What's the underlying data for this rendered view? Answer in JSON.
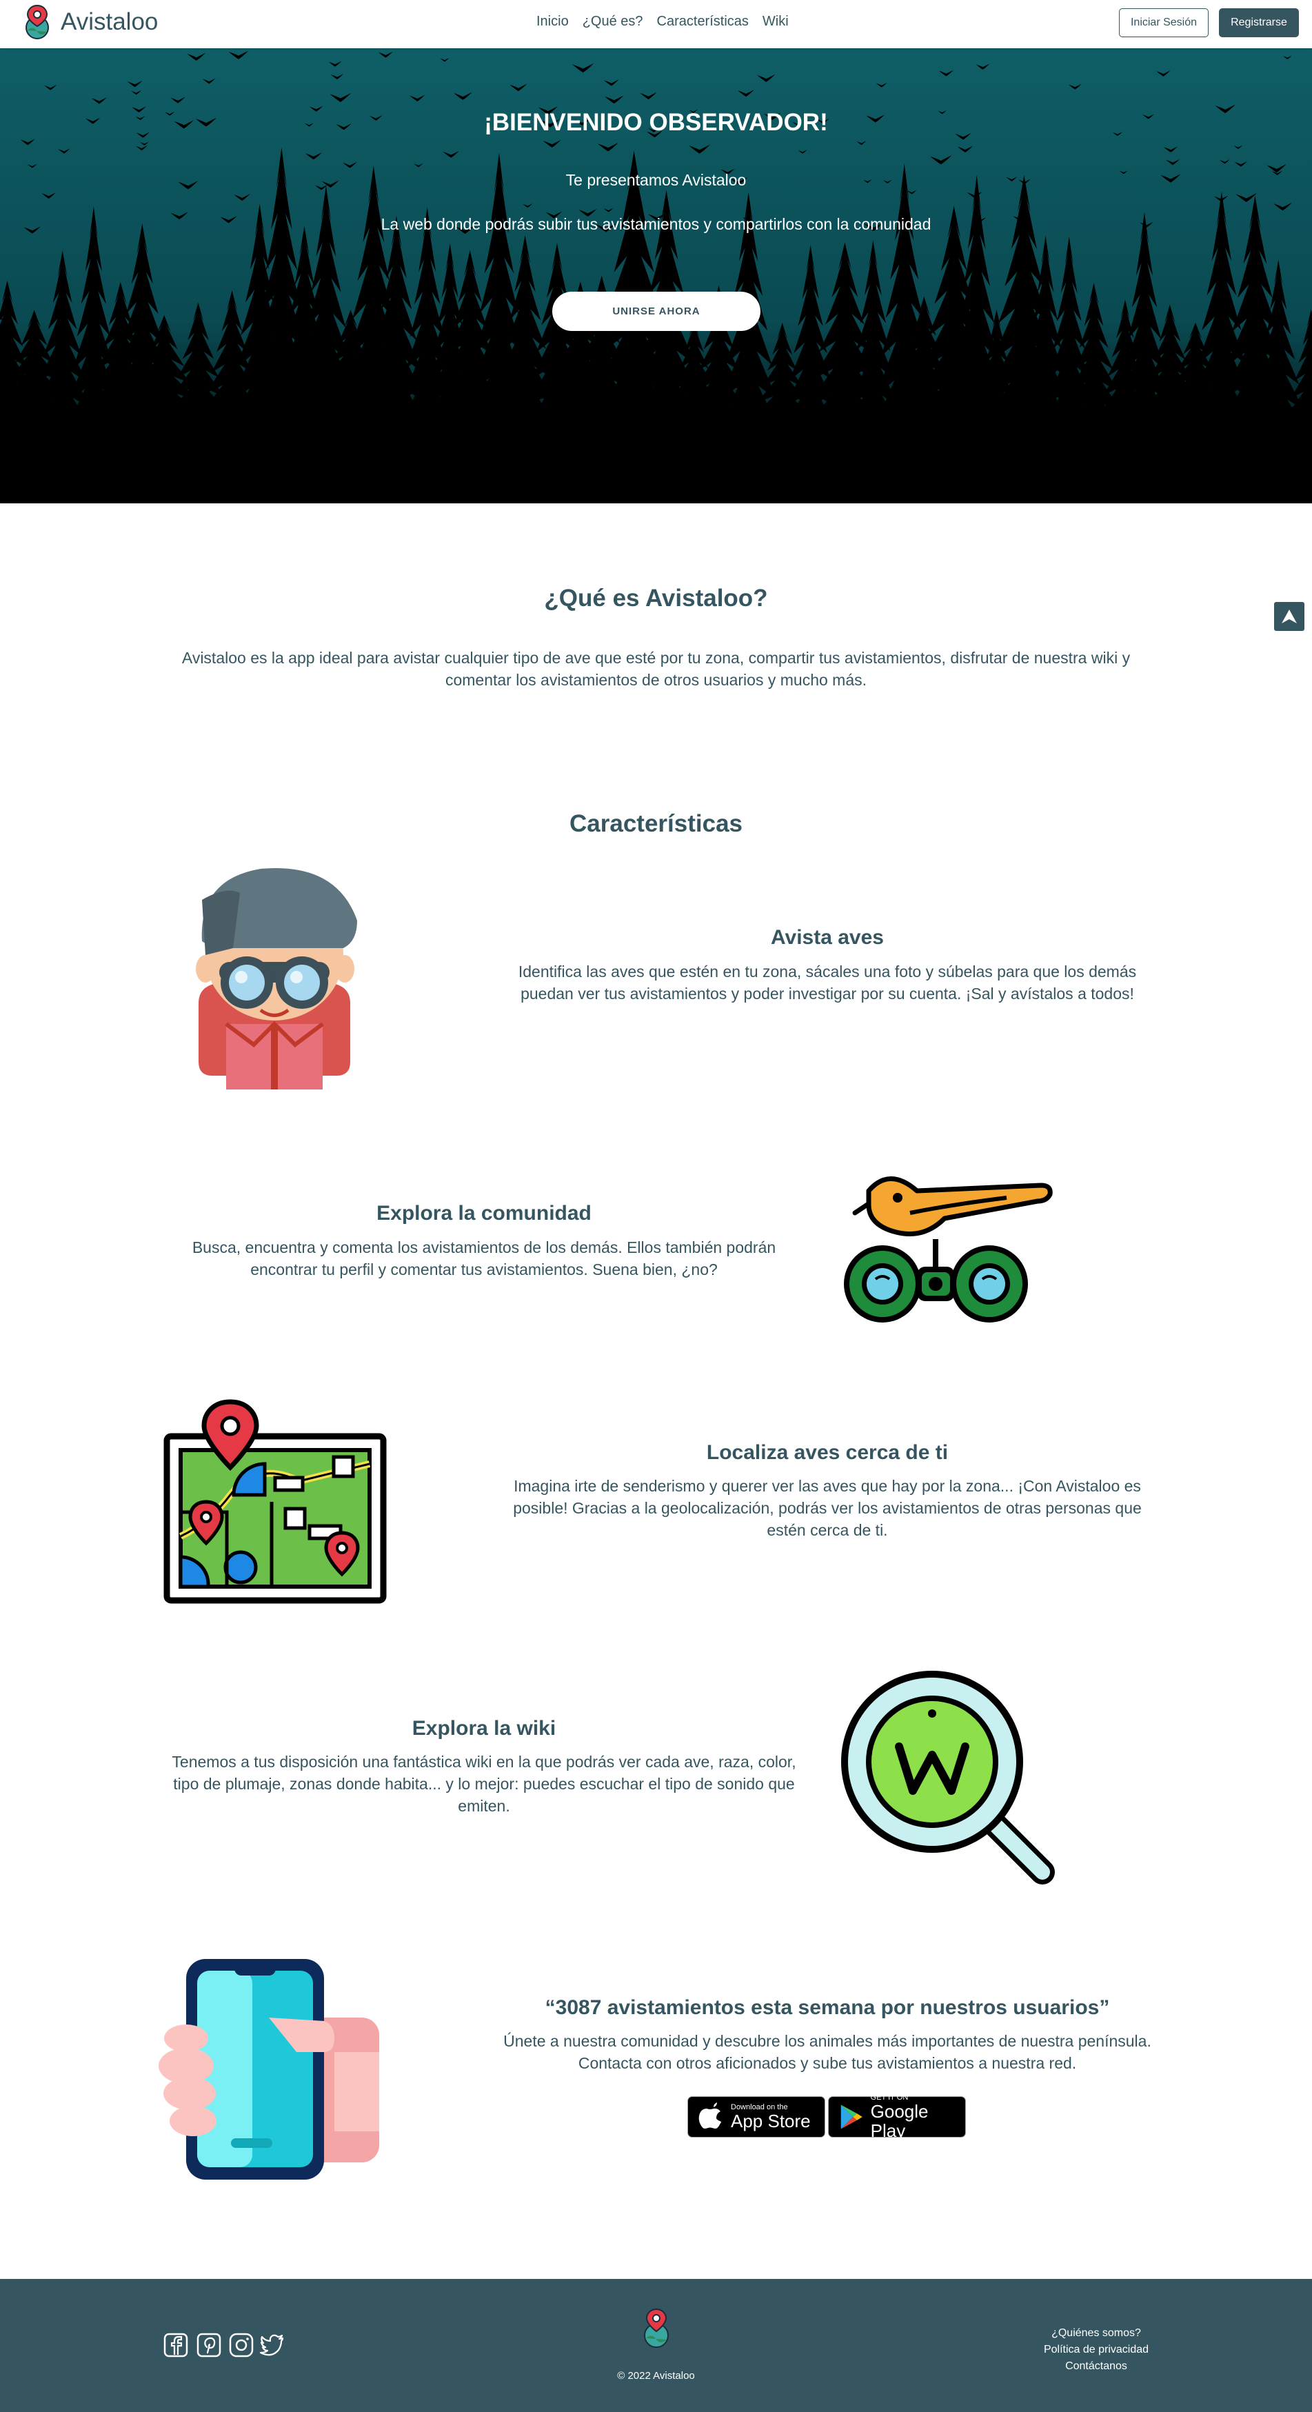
{
  "nav": {
    "brand": "Avistaloo",
    "links": [
      "Inicio",
      "¿Qué es?",
      "Características",
      "Wiki"
    ],
    "login": "Iniciar Sesión",
    "register": "Registrarse"
  },
  "hero": {
    "title": "¡BIENVENIDO OBSERVADOR!",
    "subtitle": "Te presentamos Avistaloo",
    "description": "La web donde podrás subir tus avistamientos y compartirlos con la comunidad",
    "cta": "UNIRSE AHORA"
  },
  "about": {
    "title": "¿Qué es Avistaloo?",
    "text": "Avistaloo es la app ideal para avistar cualquier tipo de ave que esté por tu zona, compartir tus avistamientos, disfrutar de nuestra wiki y comentar los avistamientos de otros usuarios y mucho más."
  },
  "features": {
    "title": "Características",
    "items": [
      {
        "title": "Avista aves",
        "text": "Identifica las aves que estén en tu zona, sácales una foto y súbelas para que los demás puedan ver tus avistamientos y poder investigar por su cuenta. ¡Sal y avístalos a todos!"
      },
      {
        "title": "Explora la comunidad",
        "text": "Busca, encuentra y comenta los avistamientos de los demás. Ellos también podrán encontrar tu perfil y comentar tus avistamientos. Suena bien, ¿no?"
      },
      {
        "title": "Localiza aves cerca de ti",
        "text": "Imagina irte de senderismo y querer ver las aves que hay por la zona... ¡Con Avistaloo es posible! Gracias a la geolocalización, podrás ver los avistamientos de otras personas que estén cerca de ti."
      },
      {
        "title": "Explora la wiki",
        "text": "Tenemos a tus disposición una fantástica wiki en la que podrás ver cada ave, raza, color, tipo de plumaje, zonas donde habita... y lo mejor: puedes escuchar el tipo de sonido que emiten."
      },
      {
        "title": "“3087 avistamientos esta semana por nuestros usuarios”",
        "text": "Únete a nuestra comunidad y descubre los animales más importantes de nuestra península. Contacta con otros aficionados y sube tus avistamientos a nuestra red."
      }
    ]
  },
  "stores": {
    "apple_small": "Download on the",
    "apple_big": "App Store",
    "google_small": "GET IT ON",
    "google_big": "Google Play"
  },
  "footer": {
    "copyright": "© 2022 Avistaloo",
    "links": [
      "¿Quiénes somos?",
      "Política de privacidad",
      "Contáctanos"
    ],
    "social_icons": [
      "facebook-icon",
      "pinterest-icon",
      "instagram-icon",
      "twitter-icon"
    ]
  },
  "colors": {
    "primary": "#355660",
    "hero_bg": "#0d5a62"
  }
}
